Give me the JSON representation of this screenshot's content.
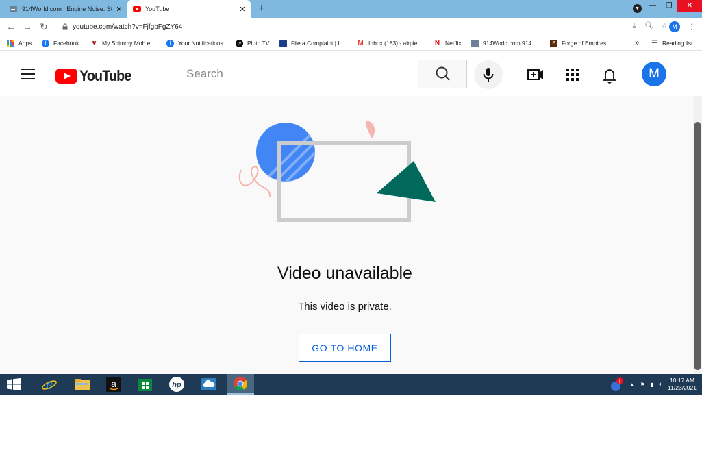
{
  "browser": {
    "tabs": [
      {
        "title": "914World.com | Engine Noise: St",
        "active": false
      },
      {
        "title": "YouTube",
        "active": true
      }
    ],
    "new_tab_label": "+",
    "url": "youtube.com/watch?v=FjfgbFgZY64",
    "profile_initial": "M",
    "bookmarks": [
      {
        "label": "Apps",
        "icon": "apps-grid-icon"
      },
      {
        "label": "Facebook",
        "icon": "facebook-icon"
      },
      {
        "label": "My Shimmy Mob e...",
        "icon": "heart-icon"
      },
      {
        "label": "Your Notifications",
        "icon": "facebook-icon"
      },
      {
        "label": "Pluto TV",
        "icon": "pluto-tv-icon"
      },
      {
        "label": "File a Complaint | L...",
        "icon": "page-icon"
      },
      {
        "label": "Inbox (183) - airpie...",
        "icon": "gmail-icon"
      },
      {
        "label": "Netflix",
        "icon": "netflix-icon"
      },
      {
        "label": "914World.com 914...",
        "icon": "page-icon"
      },
      {
        "label": "Forge of Empires",
        "icon": "game-icon"
      }
    ],
    "bookmarks_overflow": "»",
    "reading_list": "Reading list"
  },
  "youtube": {
    "logo_text": "YouTube",
    "search_placeholder": "Search",
    "avatar_initial": "M",
    "message_title": "Video unavailable",
    "message_sub": "This video is private.",
    "home_button": "GO TO HOME"
  },
  "taskbar": {
    "time": "10:17 AM",
    "date": "11/23/2021"
  },
  "colors": {
    "youtube_red": "#ff0000",
    "link_blue": "#065fd4",
    "avatar_blue": "#1a73e8",
    "tabstrip": "#7fb9e0",
    "taskbar": "#1f3a55"
  }
}
